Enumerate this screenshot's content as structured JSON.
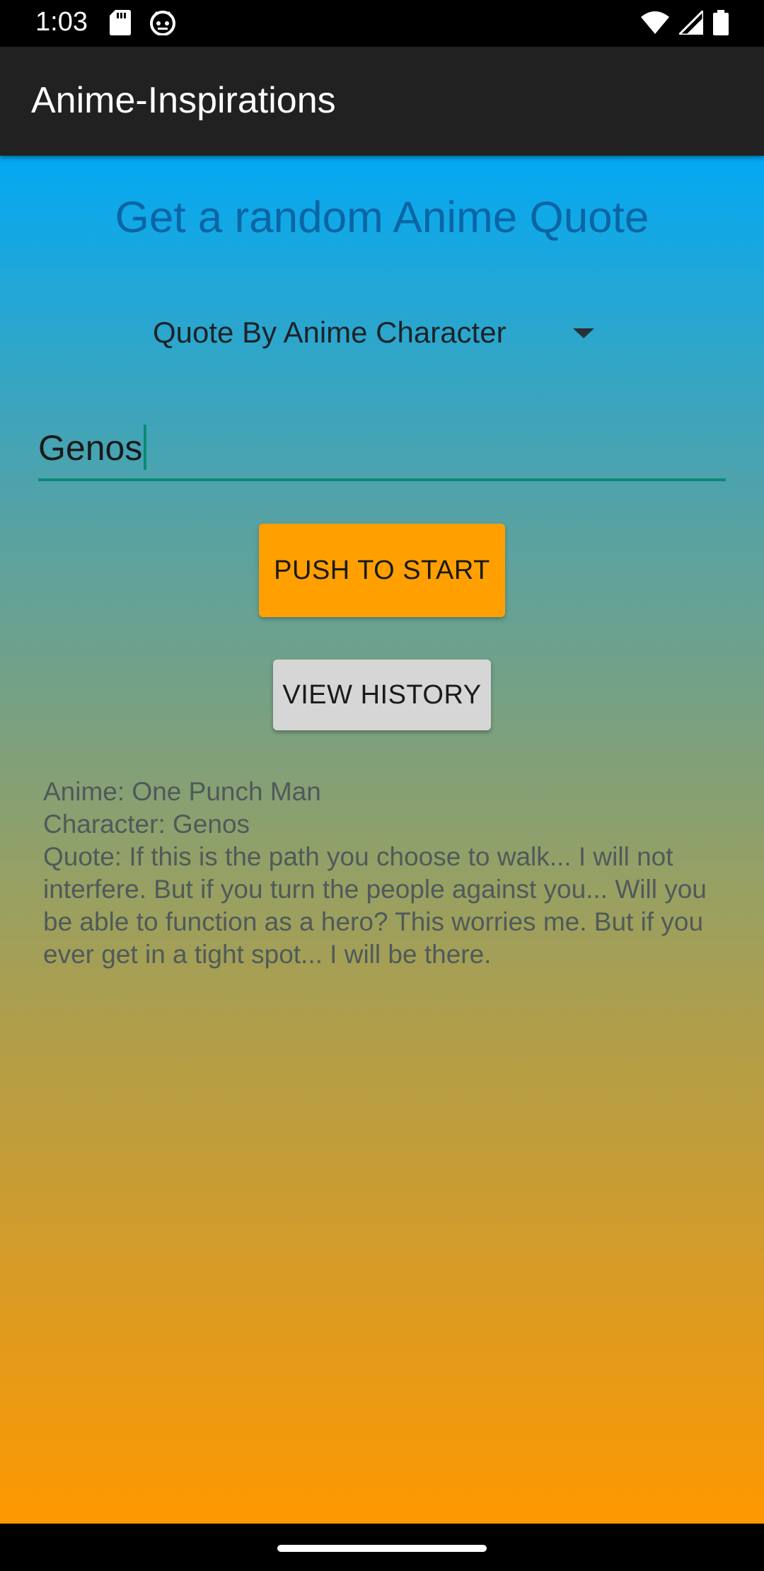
{
  "status_bar": {
    "time": "1:03",
    "left_icons": [
      "sd-card-icon",
      "cat-face-icon"
    ],
    "right_icons": [
      "wifi-icon",
      "signal-icon",
      "battery-icon"
    ]
  },
  "app_bar": {
    "title": "Anime-Inspirations"
  },
  "main": {
    "heading": "Get a random Anime Quote",
    "spinner": {
      "selected": "Quote By Anime Character"
    },
    "name_input": {
      "value": "Genos"
    },
    "start_button_label": "PUSH TO START",
    "history_button_label": "VIEW HISTORY",
    "result": {
      "anime": "Anime: One Punch Man",
      "character": "Character: Genos",
      "quote": "Quote: If this is the path you choose to walk... I will not interfere. But if you turn the people against you... Will you be able to function as a hero? This worries me. But if you ever get in a tight spot... I will be there."
    }
  },
  "colors": {
    "app_bar": "#212121",
    "gradient_top": "#03A9F4",
    "gradient_bottom": "#FF9800",
    "start_button": "#FFA000",
    "history_button": "#D6D6D6",
    "input_underline": "#0B8A75",
    "heading": "#0A65A4"
  }
}
